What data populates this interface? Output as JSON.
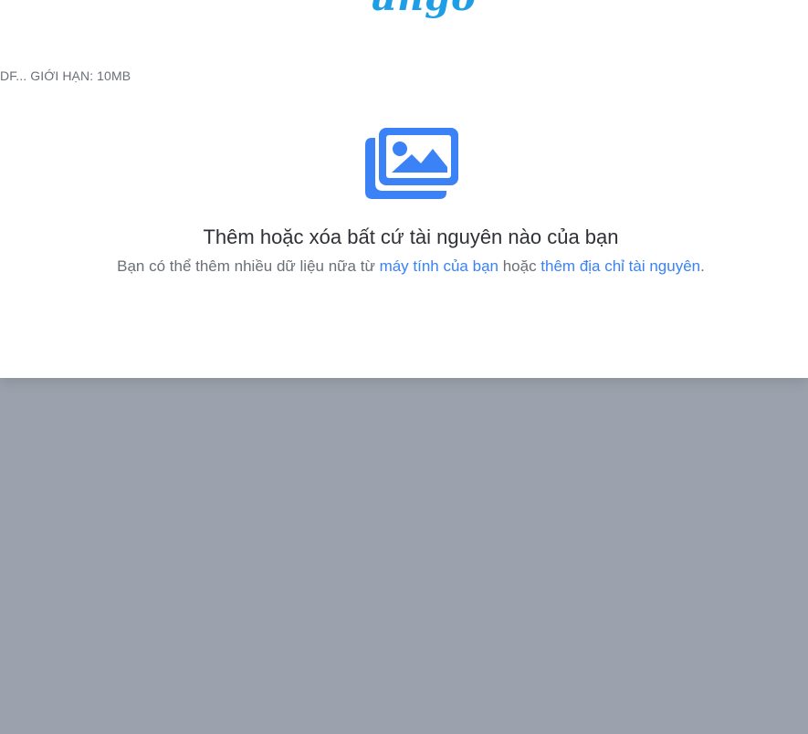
{
  "brand": {
    "logo_text": "ungoo",
    "logo_color": "#1e9ee6"
  },
  "upload": {
    "limit_text": "DF... GIỚI HẠN: 10MB",
    "icon": "images-icon",
    "title": "Thêm hoặc xóa bất cứ tài nguyên nào của bạn",
    "subtitle_prefix": "Bạn có thể thêm nhiều dữ liệu nữa từ ",
    "link_computer": "máy tính của bạn",
    "subtitle_middle": " hoặc ",
    "link_url": "thêm địa chỉ tài nguyên",
    "subtitle_suffix": "."
  },
  "colors": {
    "accent": "#3b82f6",
    "overlay": "#9ca2ad",
    "panel": "#ffffff"
  }
}
